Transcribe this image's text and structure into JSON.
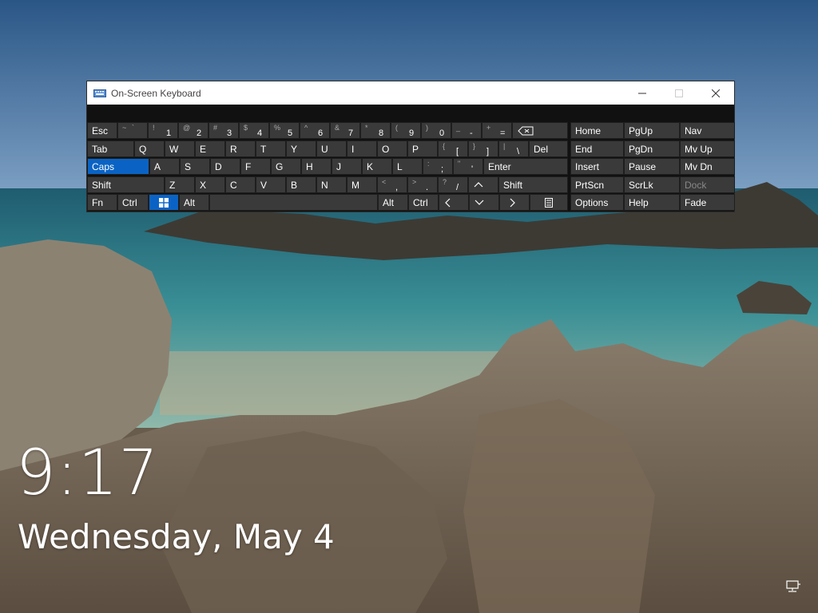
{
  "window": {
    "title": "On-Screen Keyboard",
    "icon": "keyboard-icon"
  },
  "lock_screen": {
    "time": "9:17",
    "date": "Wednesday, May 4"
  },
  "keyboard": {
    "row1": [
      {
        "label": "Esc"
      },
      {
        "sym": "~",
        "sym2": "`"
      },
      {
        "sym": "!",
        "main": "1"
      },
      {
        "sym": "@",
        "main": "2"
      },
      {
        "sym": "#",
        "main": "3"
      },
      {
        "sym": "$",
        "main": "4"
      },
      {
        "sym": "%",
        "main": "5"
      },
      {
        "sym": "^",
        "main": "6"
      },
      {
        "sym": "&",
        "main": "7"
      },
      {
        "sym": "*",
        "main": "8"
      },
      {
        "sym": "(",
        "main": "9"
      },
      {
        "sym": ")",
        "main": "0"
      },
      {
        "sym": "_",
        "main": "-"
      },
      {
        "sym": "+",
        "main": "="
      }
    ],
    "row2": [
      "Tab",
      "Q",
      "W",
      "E",
      "R",
      "T",
      "Y",
      "U",
      "I",
      "O",
      "P",
      "Del"
    ],
    "row2_sym": [
      {
        "sym": "{",
        "main": "["
      },
      {
        "sym": "}",
        "main": "]"
      },
      {
        "sym": "|",
        "main": "\\"
      }
    ],
    "row3": [
      "Caps",
      "A",
      "S",
      "D",
      "F",
      "G",
      "H",
      "J",
      "K",
      "L",
      "Enter"
    ],
    "row3_sym": [
      {
        "sym": ":",
        "main": ";"
      },
      {
        "sym": "\"",
        "main": "'"
      }
    ],
    "row4": [
      "Shift",
      "Z",
      "X",
      "C",
      "V",
      "B",
      "N",
      "M",
      "Shift"
    ],
    "row4_sym": [
      {
        "sym": "<",
        "main": ","
      },
      {
        "sym": ">",
        "main": "."
      },
      {
        "sym": "?",
        "main": "/"
      }
    ],
    "row5": [
      "Fn",
      "Ctrl",
      "Alt",
      "Alt",
      "Ctrl"
    ],
    "nav_col1": [
      "Home",
      "End",
      "Insert",
      "PrtScn",
      "Options"
    ],
    "nav_col2": [
      "PgUp",
      "PgDn",
      "Pause",
      "ScrLk",
      "Help"
    ],
    "nav_col3": [
      "Nav",
      "Mv Up",
      "Mv Dn",
      "Dock",
      "Fade"
    ]
  },
  "colors": {
    "active_key": "#0a63c4",
    "key_bg": "#3a3a3a"
  }
}
